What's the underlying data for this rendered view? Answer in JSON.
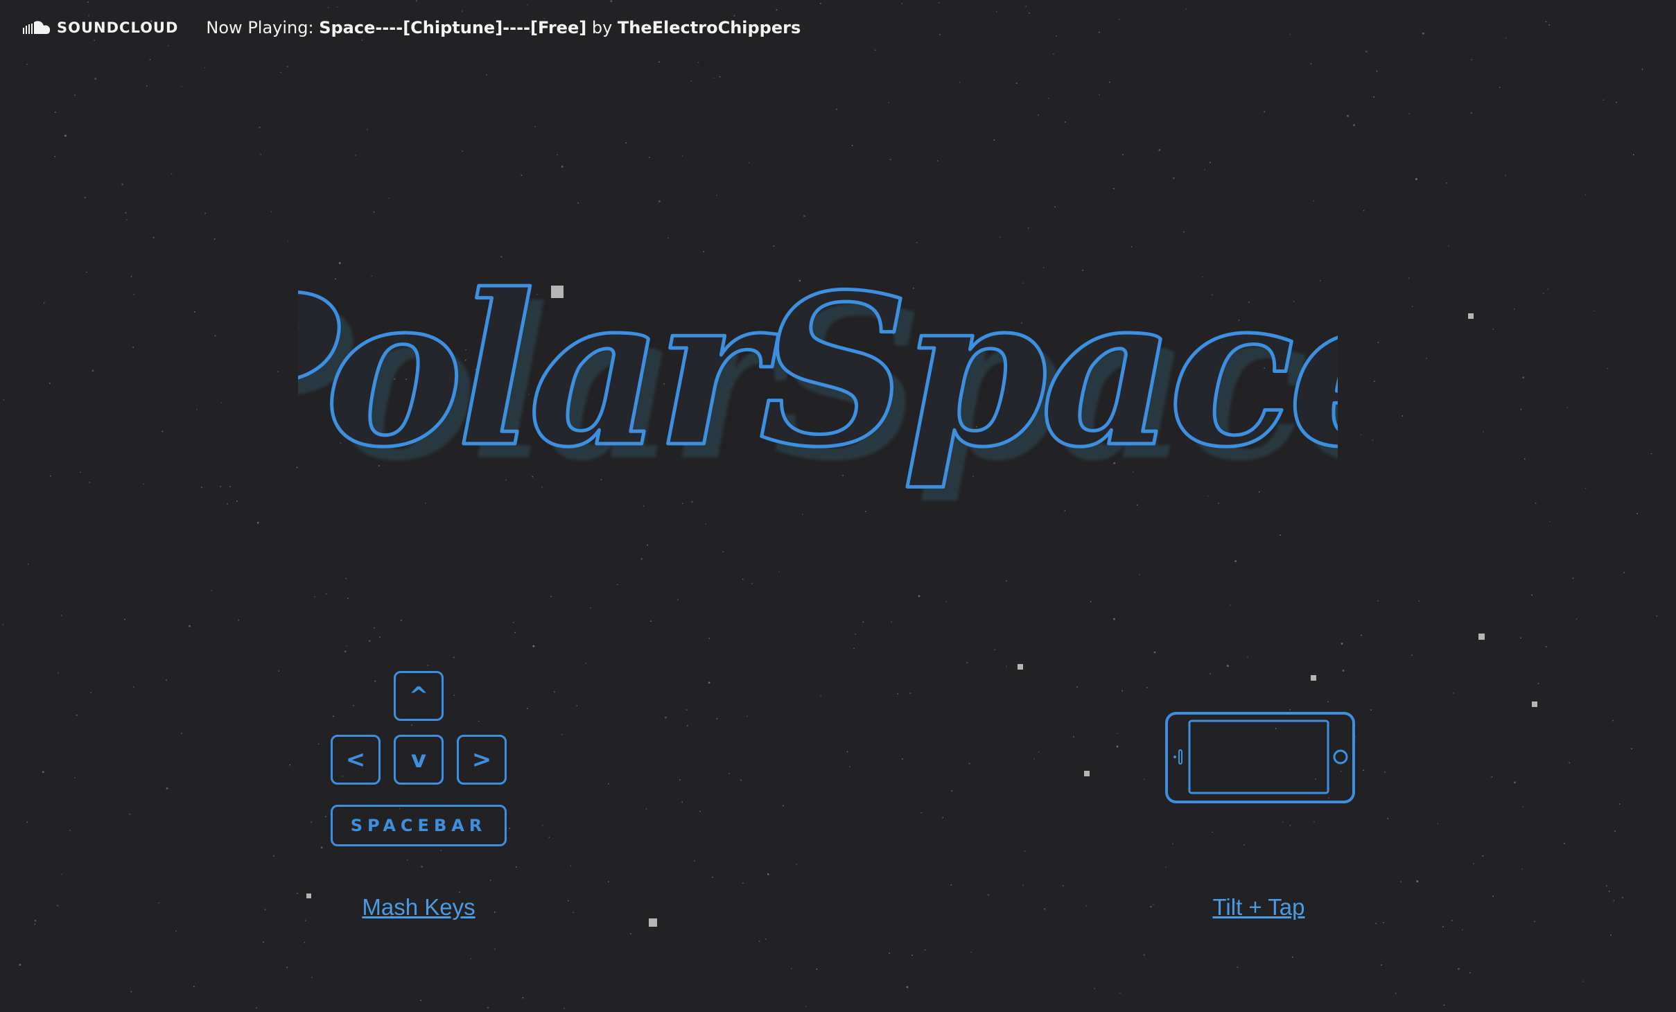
{
  "topbar": {
    "brand": "SOUNDCLOUD",
    "now_playing_prefix": "Now Playing: ",
    "track_title": "Space----[Chiptune]----[Free]",
    "by_text": " by ",
    "artist": "TheElectroChippers"
  },
  "title": {
    "text": "PolarSpace"
  },
  "controls": {
    "keyboard": {
      "up_label": "^",
      "left_label": "<",
      "down_label": "v",
      "right_label": ">",
      "space_label": "SPACEBAR",
      "mode_label": "Mash Keys"
    },
    "mobile": {
      "mode_label": "Tilt + Tap"
    }
  },
  "colors": {
    "background": "#222224",
    "accent": "#3d8fe0",
    "letter_fill": "#25262b",
    "letter_shadow": "#2c3c45",
    "text": "#f3f3f3"
  },
  "icons": {
    "brand_icon": "soundcloud-icon",
    "mobile_icon": "phone-landscape-icon"
  }
}
